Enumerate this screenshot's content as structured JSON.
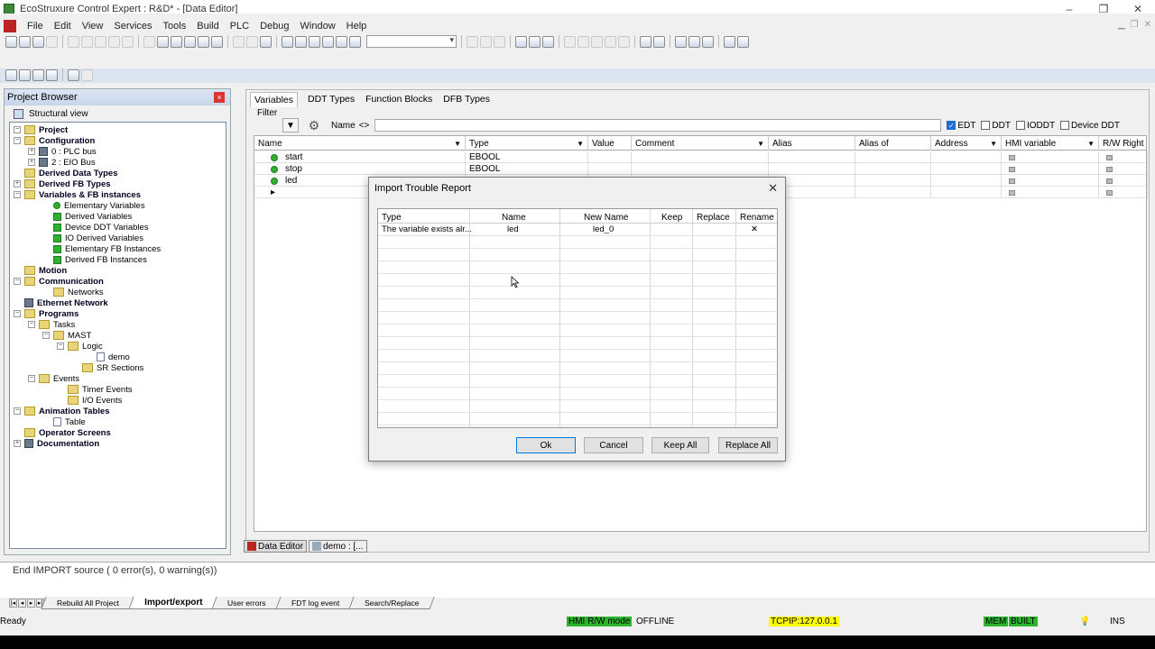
{
  "window": {
    "title": "EcoStruxure Control Expert : R&D* - [Data Editor]",
    "controls": [
      "–",
      "❐",
      "✕"
    ]
  },
  "menu": [
    "File",
    "Edit",
    "View",
    "Services",
    "Tools",
    "Build",
    "PLC",
    "Debug",
    "Window",
    "Help"
  ],
  "project_browser": {
    "title": "Project Browser",
    "view_label": "Structural view",
    "tree": [
      {
        "label": "Project",
        "bold": true
      },
      {
        "label": "Configuration",
        "bold": true
      },
      {
        "label": "0 : PLC bus",
        "bold": false
      },
      {
        "label": "2 : EIO Bus",
        "bold": false
      },
      {
        "label": "Derived Data Types",
        "bold": true
      },
      {
        "label": "Derived FB Types",
        "bold": true
      },
      {
        "label": "Variables & FB instances",
        "bold": true
      },
      {
        "label": "Elementary Variables",
        "bold": false
      },
      {
        "label": "Derived Variables",
        "bold": false
      },
      {
        "label": "Device DDT Variables",
        "bold": false
      },
      {
        "label": "IO Derived Variables",
        "bold": false
      },
      {
        "label": "Elementary FB Instances",
        "bold": false
      },
      {
        "label": "Derived FB Instances",
        "bold": false
      },
      {
        "label": "Motion",
        "bold": true
      },
      {
        "label": "Communication",
        "bold": true
      },
      {
        "label": "Networks",
        "bold": false
      },
      {
        "label": "Ethernet Network",
        "bold": true
      },
      {
        "label": "Programs",
        "bold": true
      },
      {
        "label": "Tasks",
        "bold": false
      },
      {
        "label": "MAST",
        "bold": false
      },
      {
        "label": "Logic",
        "bold": false
      },
      {
        "label": "demo",
        "bold": false
      },
      {
        "label": "SR Sections",
        "bold": false
      },
      {
        "label": "Events",
        "bold": false
      },
      {
        "label": "Timer Events",
        "bold": false
      },
      {
        "label": "I/O Events",
        "bold": false
      },
      {
        "label": "Animation Tables",
        "bold": true
      },
      {
        "label": "Table",
        "bold": false
      },
      {
        "label": "Operator Screens",
        "bold": true
      },
      {
        "label": "Documentation",
        "bold": true
      }
    ]
  },
  "editor": {
    "tabs": [
      "Variables",
      "DDT Types",
      "Function Blocks",
      "DFB Types"
    ],
    "filter_label": "Filter",
    "name_label": "Name",
    "name_arrows": "<>",
    "checkboxes": [
      {
        "label": "EDT",
        "checked": true
      },
      {
        "label": "DDT",
        "checked": false
      },
      {
        "label": "IODDT",
        "checked": false
      },
      {
        "label": "Device DDT",
        "checked": false
      }
    ],
    "columns": [
      "Name",
      "Type",
      "Value",
      "Comment",
      "Alias",
      "Alias of",
      "Address",
      "HMI variable",
      "R/W Right"
    ],
    "rows": [
      {
        "name": "start",
        "type": "EBOOL"
      },
      {
        "name": "stop",
        "type": "EBOOL"
      },
      {
        "name": "led",
        "type": ""
      }
    ],
    "new_row_marker": "▸"
  },
  "dialog": {
    "title": "Import Trouble Report",
    "close": "✕",
    "columns": [
      "Type",
      "Name",
      "New Name",
      "Keep",
      "Replace",
      "Rename"
    ],
    "rows": [
      {
        "type": "The variable exists alr...",
        "name": "led",
        "new_name": "led_0",
        "keep": "",
        "replace": "",
        "rename": "✕"
      }
    ],
    "buttons": {
      "ok": "Ok",
      "cancel": "Cancel",
      "keep_all": "Keep All",
      "replace_all": "Replace All"
    }
  },
  "doc_tabs": [
    "Data Editor",
    "demo : [..."
  ],
  "output": {
    "message": "End IMPORT source ( 0 error(s), 0 warning(s))",
    "tabs": [
      "Rebuild All Project",
      "Import/export",
      "User errors",
      "FDT log event",
      "Search/Replace"
    ]
  },
  "status": {
    "ready": "Ready",
    "hmi_mode": "HMI R/W mode",
    "offline": "OFFLINE",
    "address": "TCPIP:127.0.0.1",
    "mem": "MEM",
    "built": "BUILT",
    "ins": "INS"
  }
}
